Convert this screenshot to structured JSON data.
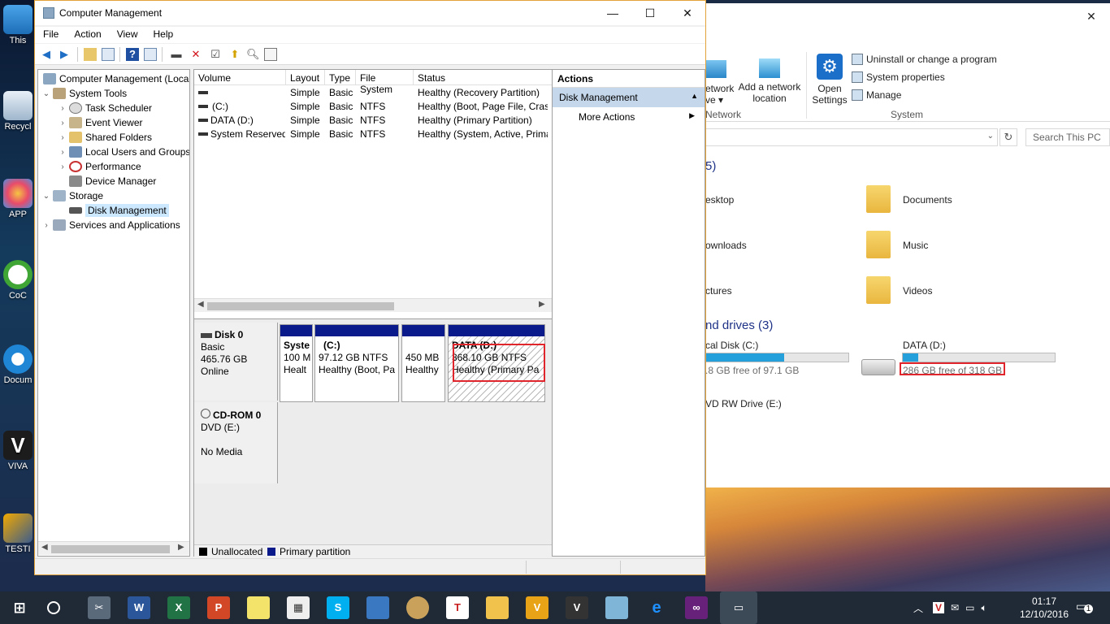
{
  "desktop": {
    "icons": [
      {
        "label": "This",
        "icon": "monitor-icon"
      },
      {
        "label": "Recycl",
        "icon": "recycle-bin-icon"
      },
      {
        "label": "APP",
        "icon": "photos-app-icon"
      },
      {
        "label": "CoC",
        "icon": "coc-shortcut-icon"
      },
      {
        "label": "Docum",
        "icon": "doraemon-shortcut-icon"
      },
      {
        "label": "VIVA",
        "icon": "viva-shortcut-icon"
      },
      {
        "label": "TESTI",
        "icon": "tools-shortcut-icon"
      }
    ]
  },
  "explorer": {
    "ribbon": {
      "network_label": "etwork",
      "network_label2": "ve ▾",
      "add_network_location": [
        "Add a network",
        "location"
      ],
      "open_settings": [
        "Open",
        "Settings"
      ],
      "uninstall": "Uninstall or change a program",
      "system_properties": "System properties",
      "manage": "Manage",
      "group_network": "Network",
      "group_system": "System"
    },
    "search_placeholder": "Search This PC",
    "folders_header": "5)",
    "folders": [
      {
        "name": "esktop"
      },
      {
        "name": "Documents"
      },
      {
        "name": "ownloads"
      },
      {
        "name": "Music"
      },
      {
        "name": "ctures"
      },
      {
        "name": "Videos"
      }
    ],
    "drives_header": "nd drives (3)",
    "drives": [
      {
        "name": "cal Disk (C:)",
        "free_text": ".8 GB free of 97.1 GB",
        "fill": 0.55
      },
      {
        "name": "DATA (D:)",
        "free_text": "286 GB free of 318 GB",
        "fill": 0.1
      },
      {
        "name": "VD RW Drive (E:)"
      }
    ]
  },
  "cm": {
    "title": "Computer Management",
    "menu": [
      "File",
      "Action",
      "View",
      "Help"
    ],
    "tree": [
      {
        "label": "Computer Management (Local",
        "level": 0,
        "expander": "",
        "icon": "computer-management-icon"
      },
      {
        "label": "System Tools",
        "level": 1,
        "expander": "⌄",
        "icon": "system-tools-icon"
      },
      {
        "label": "Task Scheduler",
        "level": 2,
        "expander": "›",
        "icon": "task-scheduler-icon"
      },
      {
        "label": "Event Viewer",
        "level": 2,
        "expander": "›",
        "icon": "event-viewer-icon"
      },
      {
        "label": "Shared Folders",
        "level": 2,
        "expander": "›",
        "icon": "shared-folders-icon"
      },
      {
        "label": "Local Users and Groups",
        "level": 2,
        "expander": "›",
        "icon": "local-users-icon"
      },
      {
        "label": "Performance",
        "level": 2,
        "expander": "›",
        "icon": "performance-icon"
      },
      {
        "label": "Device Manager",
        "level": 2,
        "expander": "",
        "icon": "device-manager-icon"
      },
      {
        "label": "Storage",
        "level": 1,
        "expander": "⌄",
        "icon": "storage-icon"
      },
      {
        "label": "Disk Management",
        "level": 2,
        "expander": "",
        "icon": "disk-management-icon",
        "selected": true
      },
      {
        "label": "Services and Applications",
        "level": 1,
        "expander": "›",
        "icon": "services-icon"
      }
    ],
    "columns": [
      "Volume",
      "Layout",
      "Type",
      "File System",
      "Status"
    ],
    "volumes": [
      {
        "volume": "",
        "layout": "Simple",
        "type": "Basic",
        "fs": "",
        "status": "Healthy (Recovery Partition)"
      },
      {
        "volume": "(C:)",
        "layout": "Simple",
        "type": "Basic",
        "fs": "NTFS",
        "status": "Healthy (Boot, Page File, Crash"
      },
      {
        "volume": "DATA (D:)",
        "layout": "Simple",
        "type": "Basic",
        "fs": "NTFS",
        "status": "Healthy (Primary Partition)"
      },
      {
        "volume": "System Reserved",
        "layout": "Simple",
        "type": "Basic",
        "fs": "NTFS",
        "status": "Healthy (System, Active, Prima"
      }
    ],
    "disk0": {
      "name": "Disk 0",
      "kind": "Basic",
      "size": "465.76 GB",
      "state": "Online",
      "partitions": [
        {
          "l1": "Syste",
          "l2": "100 M",
          "l3": "Healt"
        },
        {
          "l1": "(C:)",
          "l2": "97.12 GB NTFS",
          "l3": "Healthy (Boot, Pa"
        },
        {
          "l1": "",
          "l2": "450 MB",
          "l3": "Healthy"
        },
        {
          "l1": "DATA  (D:)",
          "l2": "368.10 GB NTFS",
          "l3": "Healthy (Primary Pa"
        }
      ]
    },
    "cdrom": {
      "name": "CD-ROM 0",
      "kind": "DVD (E:)",
      "state": "No Media"
    },
    "legend": {
      "unallocated": "Unallocated",
      "primary": "Primary partition"
    },
    "actions": {
      "header": "Actions",
      "section": "Disk Management",
      "more": "More Actions"
    }
  },
  "taskbar": {
    "apps": [
      "start-icon",
      "cortana-icon",
      "snipping-tool-icon",
      "word-icon",
      "excel-icon",
      "powerpoint-icon",
      "sticky-notes-icon",
      "calculator-icon",
      "skype-icon",
      "remote-desktop-icon",
      "paint-icon",
      "wps-icon",
      "file-explorer-icon",
      "vlc-like-icon",
      "viva-icon",
      "virtualbox-icon",
      "edge-icon",
      "visual-studio-icon",
      "computer-management-task-icon"
    ],
    "time": "01:17",
    "date": "12/10/2016",
    "notifications": "1"
  }
}
